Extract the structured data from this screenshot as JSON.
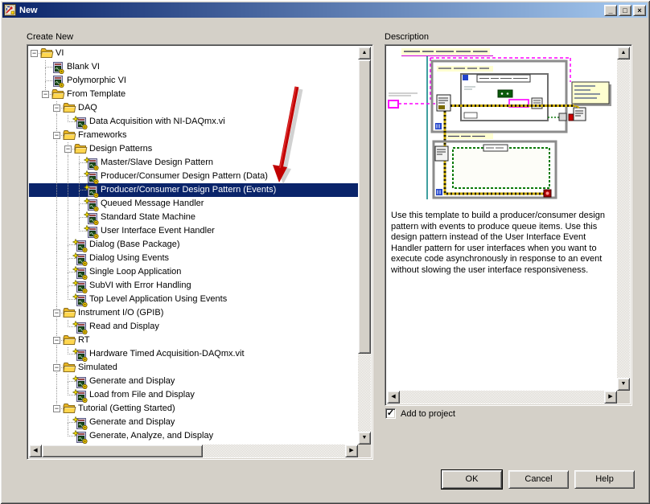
{
  "window": {
    "title": "New"
  },
  "icons": {
    "minimize": "_",
    "maximize": "□",
    "close": "×",
    "scroll_up": "▲",
    "scroll_down": "▼",
    "scroll_left": "◀",
    "scroll_right": "▶",
    "collapse": "−",
    "check": "✓"
  },
  "panels": {
    "create_new_label": "Create New",
    "description_label": "Description"
  },
  "tree": {
    "items": [
      {
        "label": "VI",
        "depth": 0,
        "type": "folder"
      },
      {
        "label": "Blank VI",
        "depth": 1,
        "type": "vi"
      },
      {
        "label": "Polymorphic VI",
        "depth": 1,
        "type": "vi"
      },
      {
        "label": "From Template",
        "depth": 1,
        "type": "folder"
      },
      {
        "label": "DAQ",
        "depth": 2,
        "type": "folder"
      },
      {
        "label": "Data Acquisition with NI-DAQmx.vi",
        "depth": 3,
        "type": "template"
      },
      {
        "label": "Frameworks",
        "depth": 2,
        "type": "folder"
      },
      {
        "label": "Design Patterns",
        "depth": 3,
        "type": "folder"
      },
      {
        "label": "Master/Slave Design Pattern",
        "depth": 4,
        "type": "template"
      },
      {
        "label": "Producer/Consumer Design Pattern (Data)",
        "depth": 4,
        "type": "template"
      },
      {
        "label": "Producer/Consumer Design Pattern (Events)",
        "depth": 4,
        "type": "template",
        "selected": true
      },
      {
        "label": "Queued Message Handler",
        "depth": 4,
        "type": "template"
      },
      {
        "label": "Standard State Machine",
        "depth": 4,
        "type": "template"
      },
      {
        "label": "User Interface Event Handler",
        "depth": 4,
        "type": "template"
      },
      {
        "label": "Dialog (Base Package)",
        "depth": 3,
        "type": "template"
      },
      {
        "label": "Dialog Using Events",
        "depth": 3,
        "type": "template"
      },
      {
        "label": "Single Loop Application",
        "depth": 3,
        "type": "template"
      },
      {
        "label": "SubVI with Error Handling",
        "depth": 3,
        "type": "template"
      },
      {
        "label": "Top Level Application Using Events",
        "depth": 3,
        "type": "template"
      },
      {
        "label": "Instrument I/O (GPIB)",
        "depth": 2,
        "type": "folder"
      },
      {
        "label": "Read and Display",
        "depth": 3,
        "type": "template"
      },
      {
        "label": "RT",
        "depth": 2,
        "type": "folder"
      },
      {
        "label": "Hardware Timed Acquisition-DAQmx.vit",
        "depth": 3,
        "type": "template"
      },
      {
        "label": "Simulated",
        "depth": 2,
        "type": "folder"
      },
      {
        "label": "Generate and Display",
        "depth": 3,
        "type": "template"
      },
      {
        "label": "Load from File and Display",
        "depth": 3,
        "type": "template"
      },
      {
        "label": "Tutorial (Getting Started)",
        "depth": 2,
        "type": "folder"
      },
      {
        "label": "Generate and Display",
        "depth": 3,
        "type": "template"
      },
      {
        "label": "Generate, Analyze, and Display",
        "depth": 3,
        "type": "template"
      }
    ]
  },
  "description": {
    "text": "Use this template to build a producer/consumer design pattern with events to produce queue items. Use this design pattern instead of the User Interface Event Handler pattern for user interfaces when you want to execute code asynchronously in response to an event without slowing the user interface responsiveness."
  },
  "add_to_project": {
    "label": "Add to project",
    "checked": true
  },
  "buttons": {
    "ok": "OK",
    "cancel": "Cancel",
    "help": "Help"
  },
  "colors": {
    "dialog_bg": "#d4d0c8",
    "selection": "#0a246a",
    "titlebar_start": "#0a246a",
    "titlebar_end": "#a6caf0",
    "arrow_red": "#c00000",
    "tree_bg": "#ffffff"
  }
}
